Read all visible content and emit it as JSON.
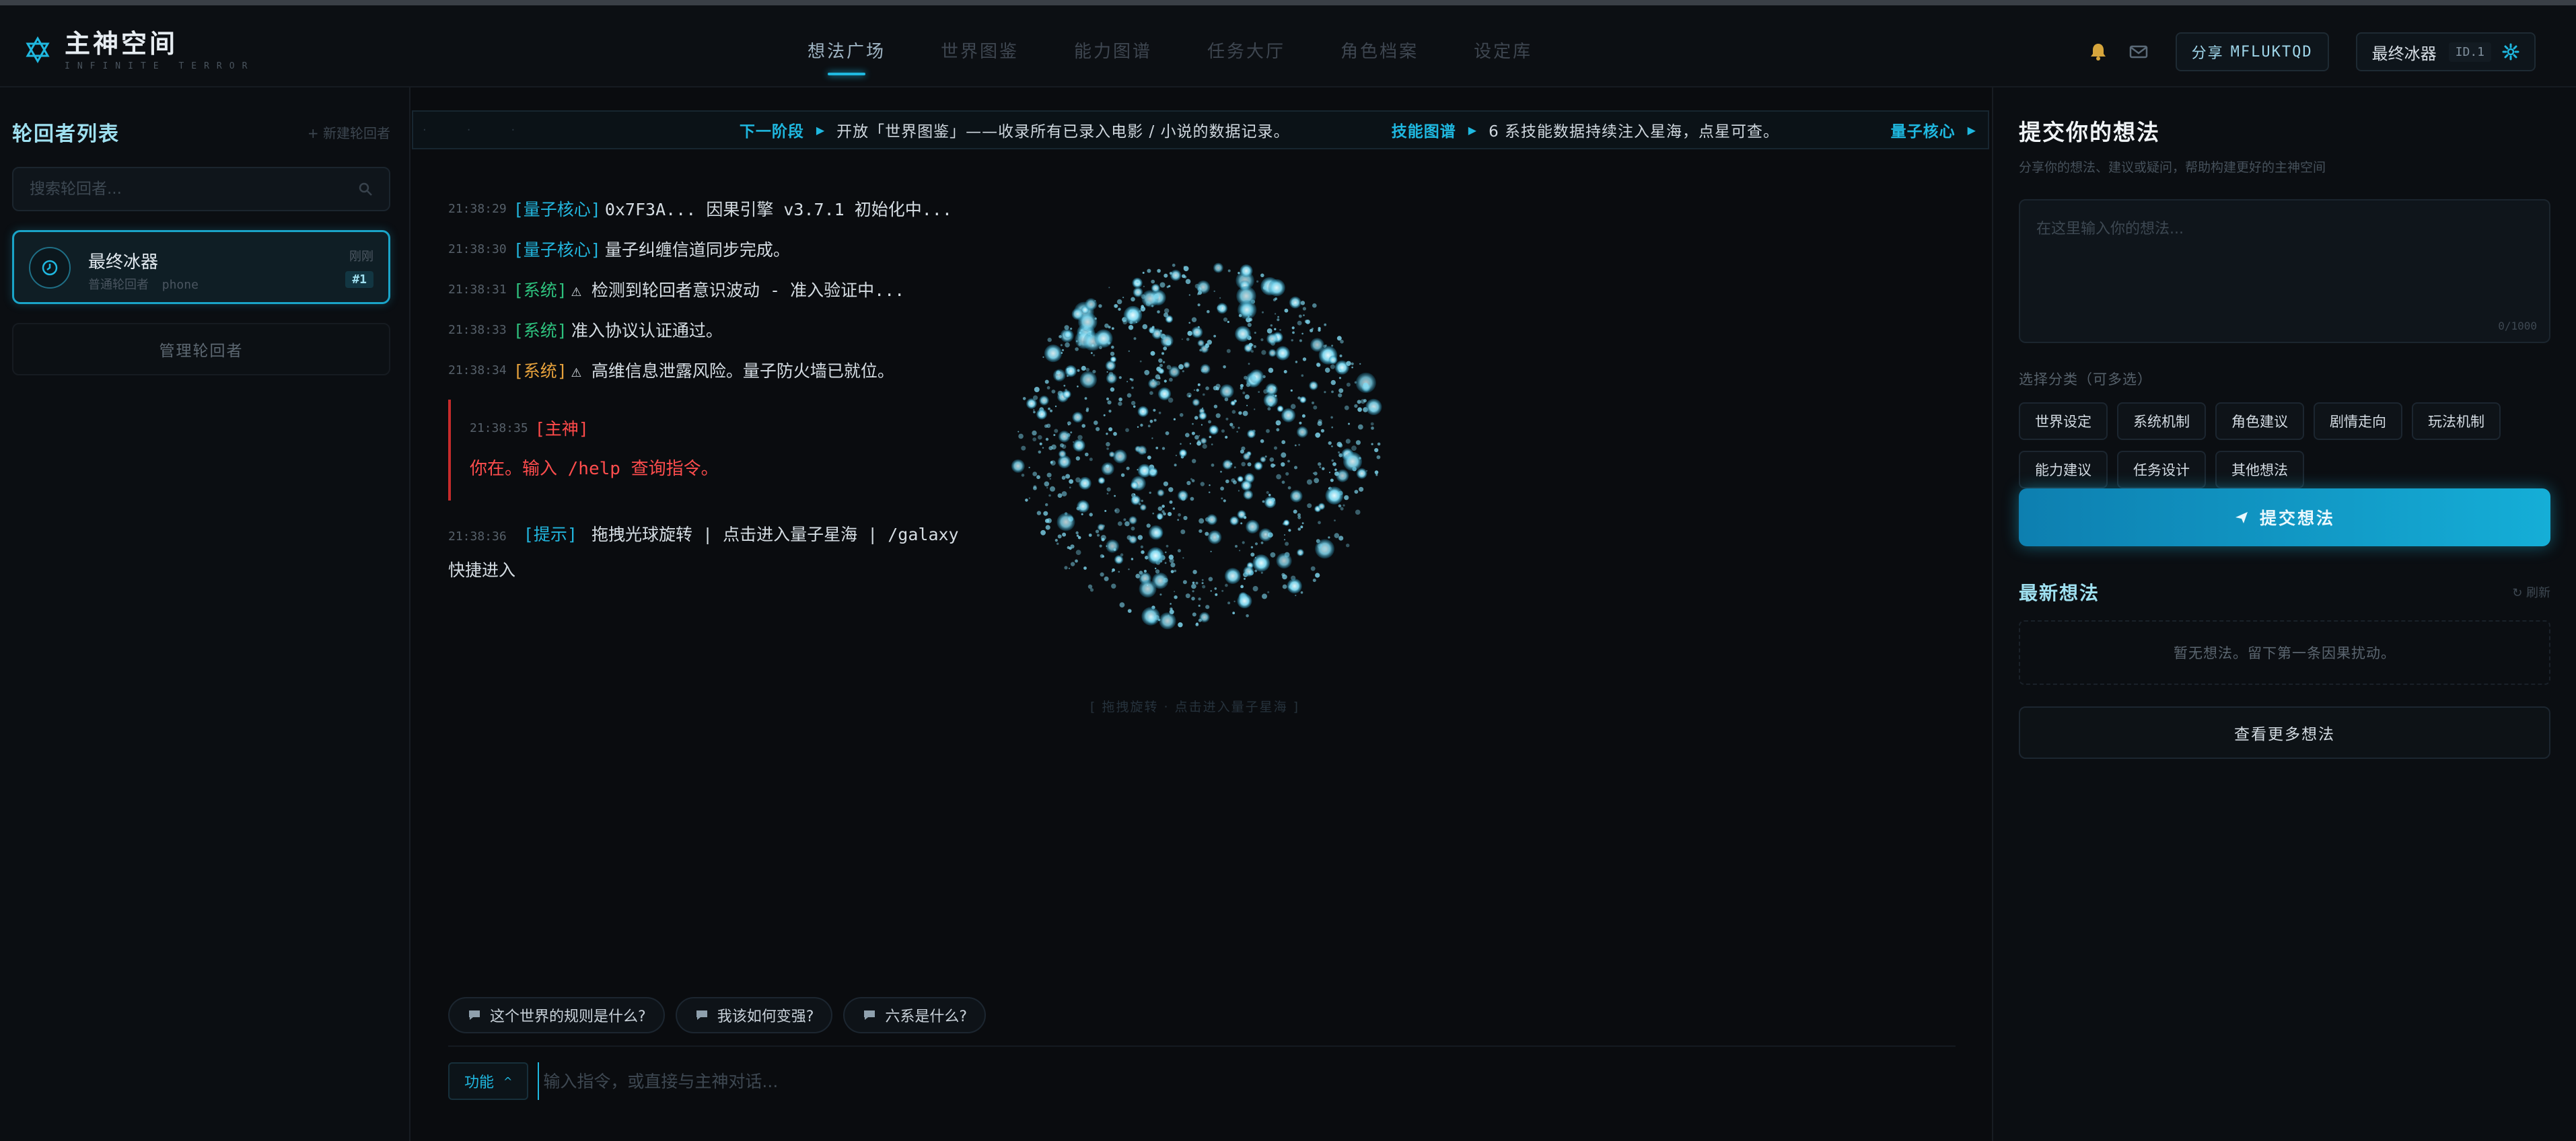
{
  "app": {
    "title": "主神空间",
    "subtitle": "INFINITE TERROR"
  },
  "nav": {
    "items": [
      {
        "label": "想法广场",
        "active": true
      },
      {
        "label": "世界图鉴",
        "active": false
      },
      {
        "label": "能力图谱",
        "active": false
      },
      {
        "label": "任务大厅",
        "active": false
      },
      {
        "label": "角色档案",
        "active": false
      },
      {
        "label": "设定库",
        "active": false
      }
    ]
  },
  "header": {
    "share_label": "分享",
    "share_code": "MFLUKTQD",
    "user_name": "最终冰器",
    "user_id": "ID.1"
  },
  "sidebar": {
    "title": "轮回者列表",
    "new_label": "+ 新建轮回者",
    "search_placeholder": "搜索轮回者...",
    "reader": {
      "name": "最终冰器",
      "role": "普通轮回者",
      "device": "phone",
      "time": "刚刚",
      "badge": "#1"
    },
    "manage_label": "管理轮回者"
  },
  "ticker": {
    "items": [
      {
        "key": "下一阶段",
        "text": "开放「世界图鉴」——收录所有已录入电影 / 小说的数据记录。"
      },
      {
        "key": "技能图谱",
        "text": "6 系技能数据持续注入星海，点星可查。"
      },
      {
        "key": "量子核心",
        "text": ""
      }
    ]
  },
  "log": {
    "lines": [
      {
        "time": "21:38:29",
        "tag": "[量子核心]",
        "tag_color": "cyan",
        "text": "0x7F3A... 因果引擎 v3.7.1 初始化中..."
      },
      {
        "time": "21:38:30",
        "tag": "[量子核心]",
        "tag_color": "cyan",
        "text": "量子纠缠信道同步完成。"
      },
      {
        "time": "21:38:31",
        "tag": "[系统]",
        "tag_color": "green",
        "text": "⚠ 检测到轮回者意识波动 - 准入验证中..."
      },
      {
        "time": "21:38:33",
        "tag": "[系统]",
        "tag_color": "green",
        "text": "准入协议认证通过。"
      },
      {
        "time": "21:38:34",
        "tag": "[系统]",
        "tag_color": "orange",
        "text": "⚠ 高维信息泄露风险。量子防火墙已就位。"
      }
    ],
    "alert": {
      "time": "21:38:35",
      "tag": "[主神]",
      "text": "你在。输入 /help 查询指令。"
    },
    "hint": {
      "time": "21:38:36",
      "tag": "[提示]",
      "text": "拖拽光球旋转 | 点击进入量子星海 | /galaxy 快捷进入"
    }
  },
  "orb": {
    "caption": "[ 拖拽旋转 · 点击进入量子星海 ]",
    "color": "#7fd8f0"
  },
  "quick_questions": [
    {
      "label": "这个世界的规则是什么?"
    },
    {
      "label": "我该如何变强?"
    },
    {
      "label": "六系是什么?"
    }
  ],
  "command": {
    "func_label": "功能",
    "placeholder": "输入指令，或直接与主神对话..."
  },
  "ideas": {
    "title": "提交你的想法",
    "subtitle": "分享你的想法、建议或疑问，帮助构建更好的主神空间",
    "placeholder": "在这里输入你的想法...",
    "counter": "0/1000",
    "category_label": "选择分类（可多选）",
    "categories": [
      {
        "label": "世界设定"
      },
      {
        "label": "系统机制"
      },
      {
        "label": "角色建议"
      },
      {
        "label": "剧情走向"
      },
      {
        "label": "玩法机制"
      },
      {
        "label": "能力建议"
      },
      {
        "label": "任务设计"
      },
      {
        "label": "其他想法"
      }
    ],
    "submit_label": "提交想法",
    "latest_title": "最新想法",
    "refresh_label": "↻ 刷新",
    "empty_text": "暂无想法。留下第一条因果扰动。",
    "more_label": "查看更多想法"
  },
  "colors": {
    "accent": "#1fb8e0",
    "background": "#0a0c0f",
    "danger": "#ff4a4a",
    "success": "#2ec27e",
    "warning": "#e7a23c"
  }
}
